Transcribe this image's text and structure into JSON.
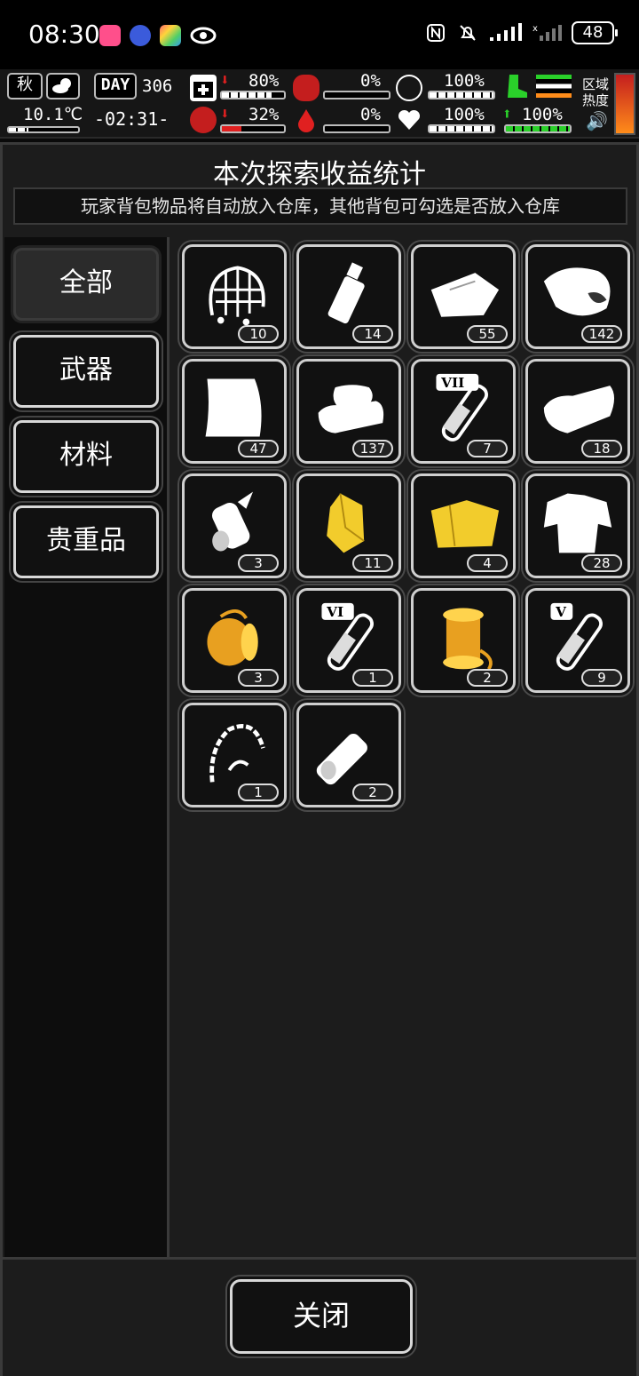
{
  "status_bar": {
    "time": "08:30",
    "battery": "48",
    "icons": [
      "nfc-icon",
      "mute-icon",
      "signal-icon",
      "signal-x-icon",
      "battery-icon",
      "eye-icon"
    ]
  },
  "hud": {
    "season": "秋",
    "temperature": "10.1℃",
    "day_label": "DAY",
    "day_value": "306",
    "clock": "-02:31-",
    "health_pct": "80%",
    "stomach_pct": "0%",
    "shield_pct": "100%",
    "infection_pct": "32%",
    "blood_pct": "0%",
    "heart_pct": "100%",
    "stamina_pct": "100%",
    "region_label_1": "区域",
    "region_label_2": "热度",
    "bar_levels": {
      "health": 0.8,
      "stomach": 0.0,
      "shield": 1.0,
      "infection": 0.32,
      "blood": 0.0,
      "heart": 1.0,
      "stamina": 1.0
    },
    "colors": {
      "danger": "#e02020",
      "good": "#2ad12a",
      "heat": "#ff5a1f"
    }
  },
  "panel": {
    "title": "本次探索收益统计",
    "subtitle": "玩家背包物品将自动放入仓库，其他背包可勾选是否放入仓库"
  },
  "categories": [
    {
      "label": "全部",
      "active": true
    },
    {
      "label": "武器",
      "active": false
    },
    {
      "label": "材料",
      "active": false
    },
    {
      "label": "贵重品",
      "active": false
    }
  ],
  "items": [
    {
      "icon": "net-icon",
      "count": "10"
    },
    {
      "icon": "grenade-icon",
      "count": "14"
    },
    {
      "icon": "cloth-icon",
      "count": "55"
    },
    {
      "icon": "meat-icon",
      "count": "142"
    },
    {
      "icon": "paper-icon",
      "count": "47"
    },
    {
      "icon": "towel-stack-icon",
      "count": "137"
    },
    {
      "icon": "test-tube-vii-icon",
      "count": "7",
      "numeral": "VII"
    },
    {
      "icon": "folded-cloth-icon",
      "count": "18"
    },
    {
      "icon": "paper-roll-icon",
      "count": "3"
    },
    {
      "icon": "gold-crystal-icon",
      "count": "11"
    },
    {
      "icon": "gold-fabric-icon",
      "count": "4"
    },
    {
      "icon": "torn-shirt-icon",
      "count": "28"
    },
    {
      "icon": "gold-thread-spool-icon",
      "count": "3"
    },
    {
      "icon": "test-tube-vi-icon",
      "count": "1",
      "numeral": "VI"
    },
    {
      "icon": "gold-bobbin-icon",
      "count": "2"
    },
    {
      "icon": "test-tube-v-icon",
      "count": "9",
      "numeral": "V"
    },
    {
      "icon": "bone-whip-icon",
      "count": "1"
    },
    {
      "icon": "rolled-bandage-icon",
      "count": "2"
    }
  ],
  "footer": {
    "close_label": "关闭"
  }
}
